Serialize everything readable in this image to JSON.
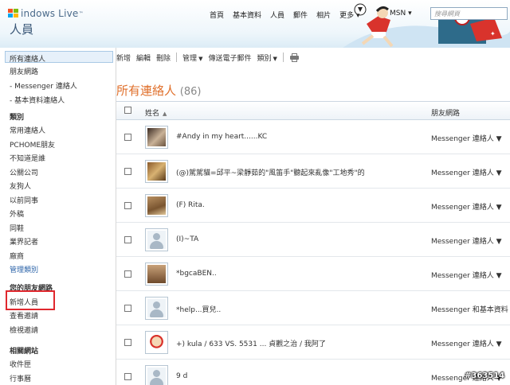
{
  "header": {
    "brand": "indows Live",
    "brand_tm": "™",
    "app_title": "人員",
    "nav": [
      "首頁",
      "基本資料",
      "人員",
      "郵件",
      "相片",
      "更多 ▾"
    ],
    "msn": "MSN ▾",
    "search_placeholder": "搜尋網頁"
  },
  "sidebar": {
    "views": [
      "所有連絡人",
      "朋友網路",
      "- Messenger 連絡人",
      "- 基本資料連絡人"
    ],
    "categories_heading": "類別",
    "categories": [
      "常用連絡人",
      "PCHOME朋友",
      "不知道是誰",
      "公關公司",
      "友狗人",
      "以前同事",
      "外稿",
      "同鞋",
      "業界記者",
      "廠商"
    ],
    "manage_categories": "管理類別",
    "network_heading": "您的朋友網路",
    "network_items": [
      "新增人員",
      "查看邀請",
      "檢視邀請"
    ],
    "related_heading": "相關網站",
    "related_items": [
      "收件匣",
      "行事曆"
    ]
  },
  "toolbar": {
    "new": "新增",
    "edit": "編輯",
    "delete": "刪除",
    "manage": "管理",
    "send_email": "傳送電子郵件",
    "category": "類別",
    "caret": "▼"
  },
  "main": {
    "title": "所有連絡人",
    "count": "(86)",
    "columns": {
      "name": "姓名",
      "sort": "▲",
      "network": "朋友網路"
    },
    "rows": [
      {
        "name": "#Andy in my heart......KC",
        "network": "Messenger 連絡人 ▼"
      },
      {
        "name": "(@)駕駕貓=邱平~梁靜茹的\"風笛手\"聽起來亂像\"工地秀\"的",
        "network": "Messenger 連絡人 ▼"
      },
      {
        "name": "(F) Rita.",
        "network": "Messenger 連絡人 ▼"
      },
      {
        "name": "(I)~TA",
        "network": "Messenger 連絡人 ▼"
      },
      {
        "name": "*bgcaBEN..",
        "network": "Messenger 連絡人 ▼"
      },
      {
        "name": "*help...買兒..",
        "network": "Messenger 和基本資料連絡人"
      },
      {
        "name": "+) kula / 633 VS. 5531 ... 貞觀之治 / 我阿了",
        "network": "Messenger 連絡人 ▼"
      },
      {
        "name": "9 d",
        "network": "Messenger 連絡人 ▼"
      }
    ]
  },
  "watermark": "#363514"
}
